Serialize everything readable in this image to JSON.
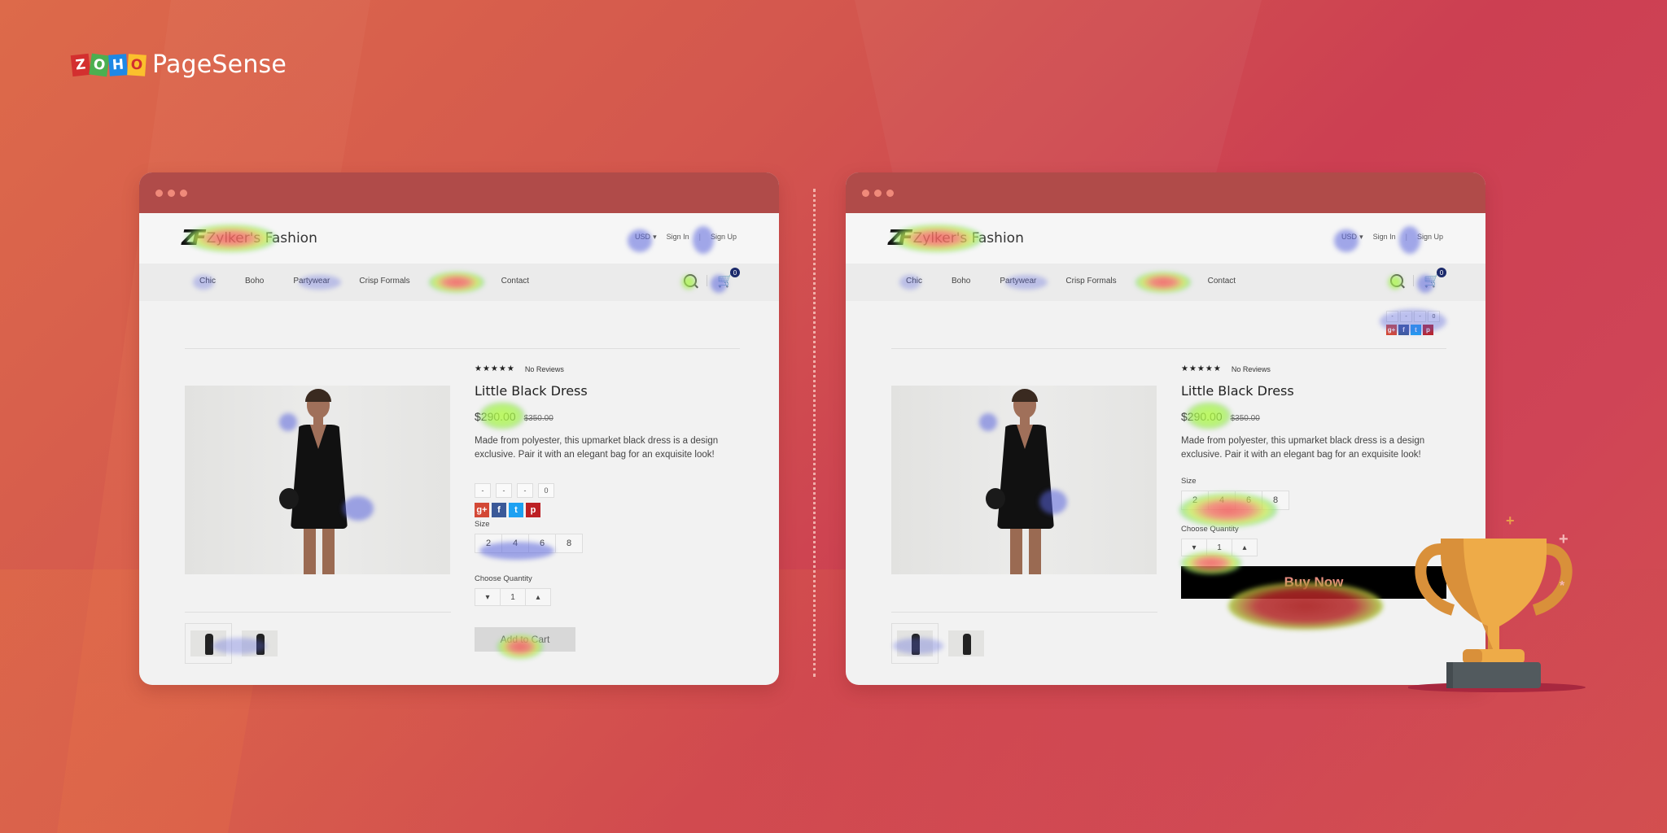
{
  "brand": {
    "zoho_letters": [
      "Z",
      "O",
      "H",
      "O"
    ],
    "product_name": "PageSense",
    "colors": {
      "z": "#d32f2f",
      "o1": "#4caf50",
      "h": "#1e88e5",
      "o2": "#fbc02d"
    }
  },
  "theme": {
    "background_start": "#dd6a4a",
    "background_end": "#cc3f52",
    "window_titlebar": "#b04b49",
    "heatmap_cool": "#5a64dc",
    "heatmap_hot": "#f05a5a",
    "trophy_gold": "#eeab48",
    "trophy_base": "#525a5e"
  },
  "windows": [
    {
      "id": "variant-a",
      "site": {
        "logo_mark": "ZF",
        "name": "Zylker's Fashion",
        "currency": "USD",
        "currency_caret": "▾",
        "sign_in": "Sign In",
        "sign_up": "Sign Up",
        "nav": [
          "Chic",
          "Boho",
          "Partywear",
          "Crisp Formals",
          "",
          "Contact"
        ],
        "cart_count": "0"
      },
      "product": {
        "stars": "★★★★★",
        "reviews": "No Reviews",
        "title": "Little Black Dress",
        "price": "$290.00",
        "old_price": "$350.00",
        "description": "Made from polyester, this upmarket black dress is a design exclusive. Pair it with an elegant bag for an exquisite look!",
        "share_counts": [
          "-",
          "-",
          "-",
          "0"
        ],
        "social": [
          "g+",
          "f",
          "t",
          "p"
        ],
        "size_label": "Size",
        "sizes": [
          "2",
          "4",
          "6",
          "8"
        ],
        "quantity_label": "Choose Quantity",
        "qty_decrement": "▾",
        "quantity": "1",
        "qty_increment": "▴",
        "cta": "Add to Cart"
      }
    },
    {
      "id": "variant-b",
      "site": {
        "logo_mark": "ZF",
        "name": "Zylker's Fashion",
        "currency": "USD",
        "currency_caret": "▾",
        "sign_in": "Sign In",
        "sign_up": "Sign Up",
        "nav": [
          "Chic",
          "Boho",
          "Partywear",
          "Crisp Formals",
          "",
          "Contact"
        ],
        "cart_count": "0"
      },
      "product": {
        "stars": "★★★★★",
        "reviews": "No Reviews",
        "title": "Little Black Dress",
        "price": "$290.00",
        "old_price": "$350.00",
        "description": "Made from polyester, this upmarket black dress is a design exclusive. Pair it with an elegant bag for an exquisite look!",
        "share_counts": [
          "-",
          "-",
          "-",
          "0"
        ],
        "social": [
          "g+",
          "f",
          "t",
          "p"
        ],
        "size_label": "Size",
        "sizes": [
          "2",
          "4",
          "6",
          "8"
        ],
        "quantity_label": "Choose Quantity",
        "qty_decrement": "▾",
        "quantity": "1",
        "qty_increment": "▴",
        "cta": "Buy Now"
      }
    }
  ],
  "decorations": {
    "sparkles": [
      "+",
      "+",
      "*"
    ]
  }
}
